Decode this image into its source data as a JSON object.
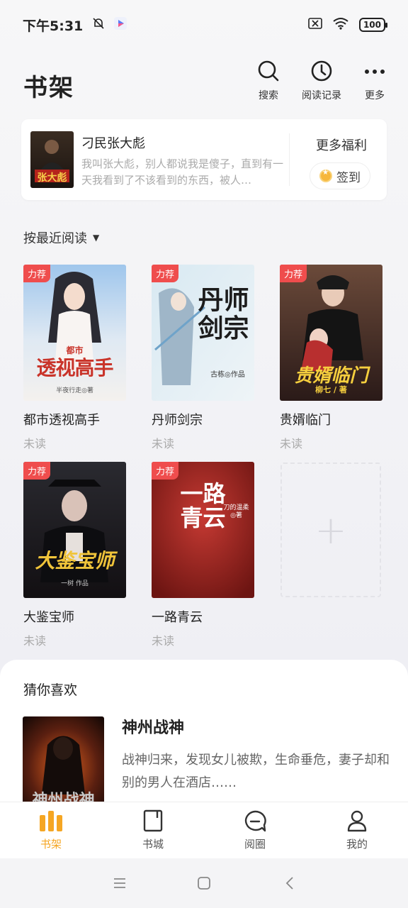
{
  "status_bar": {
    "time": "下午5:31",
    "battery": "100"
  },
  "header": {
    "title": "书架",
    "actions": [
      {
        "label": "搜索",
        "icon": "search-icon"
      },
      {
        "label": "阅读记录",
        "icon": "clock-icon"
      },
      {
        "label": "更多",
        "icon": "more-icon"
      }
    ]
  },
  "promo": {
    "cover_text": "张大彪",
    "title": "刁民张大彪",
    "desc": "我叫张大彪，别人都说我是傻子，直到有一天我看到了不该看到的东西，被人…",
    "more_label": "更多福利",
    "checkin_label": "签到"
  },
  "sort_label": "按最近阅读",
  "books": [
    {
      "tag": "力荐",
      "name": "都市透视高手",
      "status": "未读",
      "cover_text": "透视高手",
      "cover_sub": "都市",
      "author_line": "半夜行走◎著"
    },
    {
      "tag": "力荐",
      "name": "丹师剑宗",
      "status": "未读",
      "cover_text": "丹师剑宗",
      "author_line": "古栋◎作品"
    },
    {
      "tag": "力荐",
      "name": "贵婿临门",
      "status": "未读",
      "cover_text": "贵婿临门",
      "author_line": "柳七 / 著"
    },
    {
      "tag": "力荐",
      "name": "大鉴宝师",
      "status": "未读",
      "cover_text": "大鉴宝师",
      "author_line": "一树 作品"
    },
    {
      "tag": "力荐",
      "name": "一路青云",
      "status": "未读",
      "cover_text": "一路青云",
      "author_line": "刀的温柔◎著"
    }
  ],
  "add_slot_symbol": "+",
  "recommend": {
    "title": "猜你喜欢",
    "book": {
      "name": "神州战神",
      "cover_text": "神州战神",
      "desc": "战神归来，发现女儿被欺，生命垂危，妻子却和别的男人在酒店……"
    }
  },
  "bottom_nav": [
    {
      "label": "书架",
      "icon": "bookshelf-icon",
      "active": true
    },
    {
      "label": "书城",
      "icon": "book-icon",
      "active": false
    },
    {
      "label": "阅圈",
      "icon": "chat-icon",
      "active": false
    },
    {
      "label": "我的",
      "icon": "user-icon",
      "active": false
    }
  ],
  "colors": {
    "accent": "#f5a623",
    "tag": "#ef4d4d"
  }
}
